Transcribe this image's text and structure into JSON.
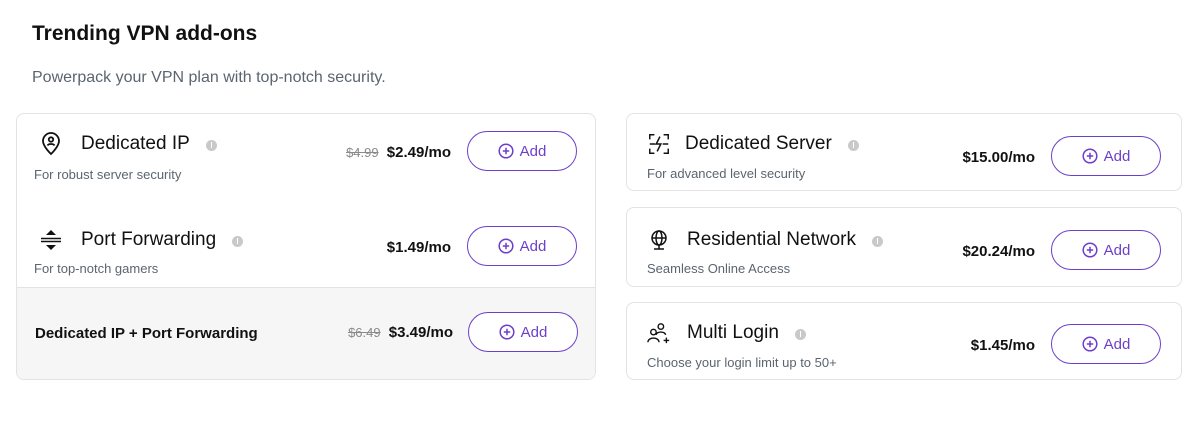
{
  "section": {
    "title": "Trending VPN add-ons",
    "subtitle": "Powerpack your VPN plan with top-notch security."
  },
  "left": {
    "dedicated_ip": {
      "name": "Dedicated IP",
      "desc": "For robust server security",
      "old_price": "$4.99",
      "price": "$2.49/mo",
      "icon": "location-pin-user-icon"
    },
    "port_forwarding": {
      "name": "Port Forwarding",
      "desc": "For top-notch gamers",
      "price": "$1.49/mo",
      "icon": "port-arrows-icon"
    },
    "bundle": {
      "name": "Dedicated IP + Port Forwarding",
      "old_price": "$6.49",
      "price": "$3.49/mo"
    }
  },
  "right": {
    "dedicated_server": {
      "name": "Dedicated Server",
      "desc": "For advanced level security",
      "price": "$15.00/mo",
      "icon": "server-bolt-icon"
    },
    "residential_network": {
      "name": "Residential Network",
      "desc": "Seamless Online Access",
      "price": "$20.24/mo",
      "icon": "globe-icon"
    },
    "multi_login": {
      "name": "Multi Login",
      "desc": "Choose your login limit up to 50+",
      "price": "$1.45/mo",
      "icon": "users-plus-icon"
    }
  },
  "add_label": "Add",
  "colors": {
    "accent": "#6d3fc9",
    "border": "#e3e3e3",
    "muted": "#5a6570"
  }
}
